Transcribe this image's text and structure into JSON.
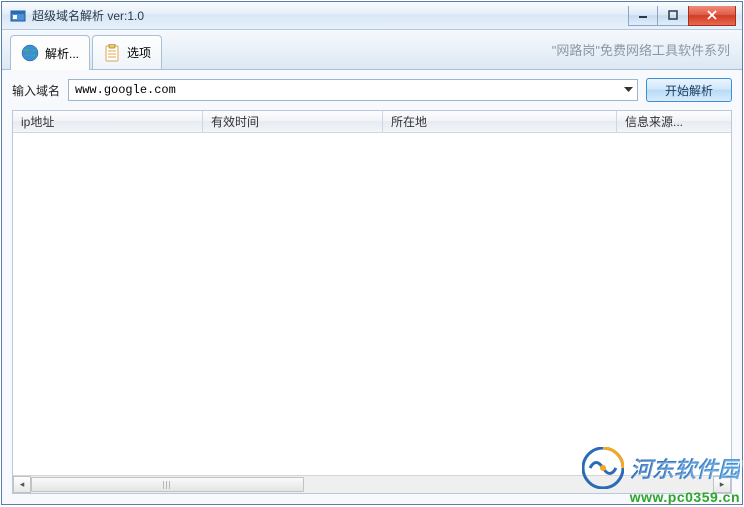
{
  "window": {
    "title": "超级域名解析 ver:1.0"
  },
  "tabs": [
    {
      "label": "解析...",
      "icon": "globe-icon"
    },
    {
      "label": "选项",
      "icon": "clipboard-icon"
    }
  ],
  "brand": "\"网路岗\"免费网络工具软件系列",
  "input": {
    "label": "输入域名",
    "value": "www.google.com"
  },
  "buttons": {
    "start": "开始解析"
  },
  "table": {
    "columns": [
      "ip地址",
      "有效时间",
      "所在地",
      "信息来源..."
    ],
    "rows": []
  },
  "watermark": {
    "site_name": "河东软件园",
    "site_url": "www.pc0359.cn"
  },
  "colors": {
    "titlebar_border": "#5a7ea5",
    "accent": "#3a8fd6",
    "close_btn": "#d13a22"
  }
}
